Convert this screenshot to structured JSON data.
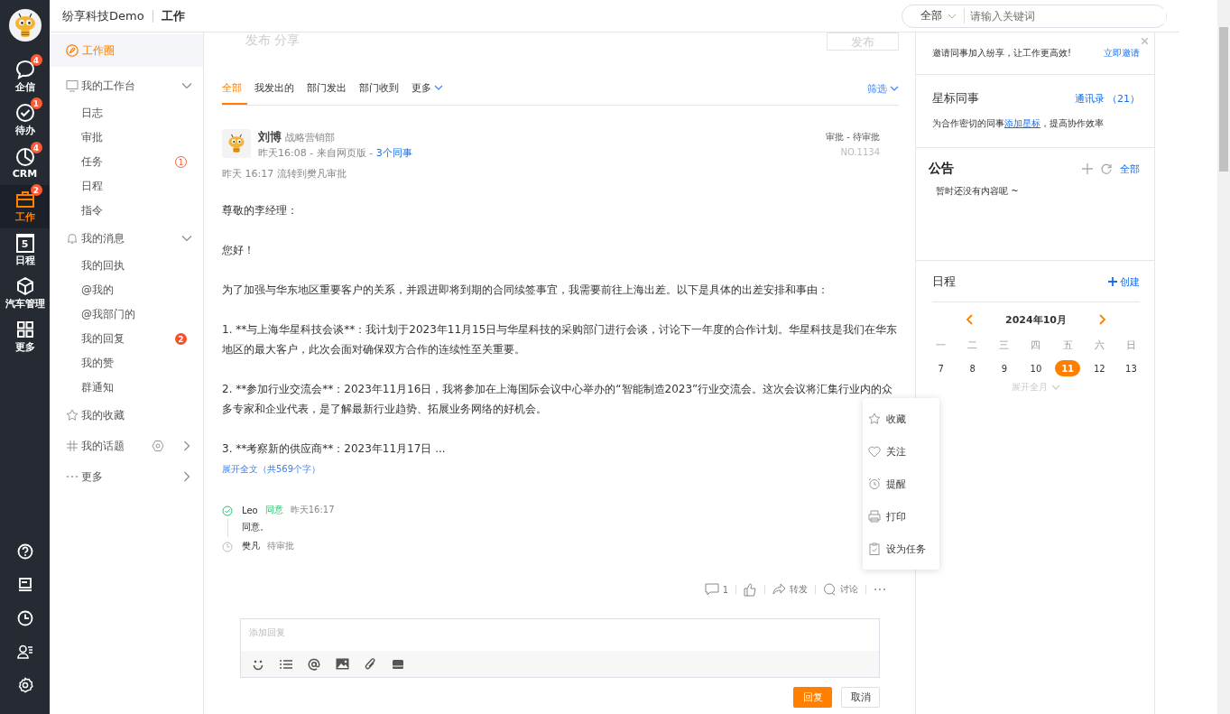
{
  "header": {
    "company": "纷享科技Demo",
    "section": "工作",
    "search": {
      "scope": "全部",
      "placeholder": "请输入关键词"
    }
  },
  "rail": {
    "items": [
      {
        "label": "企信",
        "badge": "4",
        "selected": false
      },
      {
        "label": "待办",
        "badge": "1",
        "selected": false
      },
      {
        "label": "CRM",
        "badge": "4",
        "selected": false
      },
      {
        "label": "工作",
        "badge": "2",
        "selected": true
      },
      {
        "label": "日程",
        "day": "5",
        "selected": false
      },
      {
        "label": "汽车管理",
        "selected": false
      },
      {
        "label": "更多",
        "selected": false
      }
    ]
  },
  "nav": [
    {
      "label": "工作圈",
      "kind": "top",
      "selected": true
    },
    {
      "label": "我的工作台",
      "kind": "group",
      "selected": false,
      "expanded": true,
      "children": [
        {
          "label": "日志",
          "selected": false
        },
        {
          "label": "审批",
          "selected": false
        },
        {
          "label": "任务",
          "selected": false,
          "badge": {
            "text": "1",
            "kind": "outline"
          }
        },
        {
          "label": "日程",
          "selected": false
        },
        {
          "label": "指令",
          "selected": false
        }
      ]
    },
    {
      "label": "我的消息",
      "kind": "group",
      "selected": false,
      "expanded": true,
      "children": [
        {
          "label": "我的回执",
          "selected": false
        },
        {
          "label": "@我的",
          "selected": false
        },
        {
          "label": "@我部门的",
          "selected": false
        },
        {
          "label": "我的回复",
          "selected": false,
          "badge": {
            "text": "2",
            "kind": "filled"
          }
        },
        {
          "label": "我的赞",
          "selected": false
        },
        {
          "label": "群通知",
          "selected": false
        }
      ]
    },
    {
      "label": "我的收藏",
      "kind": "plain",
      "selected": false
    },
    {
      "label": "我的话题",
      "kind": "topic",
      "selected": false,
      "expanded": false
    },
    {
      "label": "更多",
      "kind": "more",
      "selected": false,
      "expanded": false
    }
  ],
  "composer": {
    "placeholder": "发布 分享",
    "button": "发布"
  },
  "tabs": [
    {
      "label": "全部",
      "kind": "plain",
      "selected": true
    },
    {
      "label": "我发出的",
      "kind": "plain",
      "selected": false
    },
    {
      "label": "部门发出",
      "kind": "plain",
      "selected": false
    },
    {
      "label": "部门收到",
      "kind": "plain",
      "selected": false
    },
    {
      "label": "更多",
      "kind": "dropdown",
      "selected": false
    }
  ],
  "filter": "筛选",
  "post": {
    "author": "刘博",
    "department": "战略营销部",
    "meta": "昨天16:08 - 来自网页版 - ",
    "colleagues": "3个同事",
    "type": "审批 - 待审批",
    "number": "NO.1134",
    "flow": "昨天 16:17 流转到樊凡审批",
    "paragraphs": [
      "尊敬的李经理：",
      "您好！",
      "为了加强与华东地区重要客户的关系，并跟进即将到期的合同续签事宜，我需要前往上海出差。以下是具体的出差安排和事由：",
      "1. **与上海华星科技会谈**：我计划于2023年11月15日与华星科技的采购部门进行会谈，讨论下一年度的合作计划。华星科技是我们在华东地区的最大客户，此次会面对确保双方合作的连续性至关重要。",
      "2. **参加行业交流会**：2023年11月16日，我将参加在上海国际会议中心举办的“智能制造2023”行业交流会。这次会议将汇集行业内的众多专家和企业代表，是了解最新行业趋势、拓展业务网络的好机会。",
      "3. **考察新的供应商**：2023年11月17日 ..."
    ],
    "expand": "展开全文（共569个字）",
    "approvals": [
      {
        "name": "Leo",
        "status": "同意",
        "kind": "approved",
        "time": "昨天16:17",
        "comment": "同意。"
      },
      {
        "name": "樊凡",
        "status": "待审批",
        "kind": "pending"
      }
    ],
    "actions": {
      "comments": "1",
      "forward": "转发",
      "discuss": "讨论"
    },
    "menu": [
      "收藏",
      "关注",
      "提醒",
      "打印",
      "设为任务"
    ],
    "reply": {
      "placeholder": "添加回复",
      "submit": "回复",
      "cancel": "取消"
    }
  },
  "right": {
    "invite": {
      "text": "邀请同事加入纷享，让工作更高效!",
      "link": "立即邀请"
    },
    "starred": {
      "title": "星标同事",
      "link": "通讯录 （21）",
      "text_before": "为合作密切的同事",
      "text_link": "添加星标",
      "text_after": "，提高协作效率"
    },
    "notice": {
      "title": "公告",
      "all": "全部",
      "empty": "暂时还没有内容呢 ~"
    },
    "schedule": {
      "title": "日程",
      "create": "创建",
      "month": "2024年10月",
      "weekdays": [
        "一",
        "二",
        "三",
        "四",
        "五",
        "六",
        "日"
      ],
      "days": [
        {
          "day": "7",
          "selected": false
        },
        {
          "day": "8",
          "selected": false
        },
        {
          "day": "9",
          "selected": false
        },
        {
          "day": "10",
          "selected": false
        },
        {
          "day": "11",
          "selected": true
        },
        {
          "day": "12",
          "selected": false
        },
        {
          "day": "13",
          "selected": false
        }
      ],
      "expand": "展开全月"
    }
  }
}
